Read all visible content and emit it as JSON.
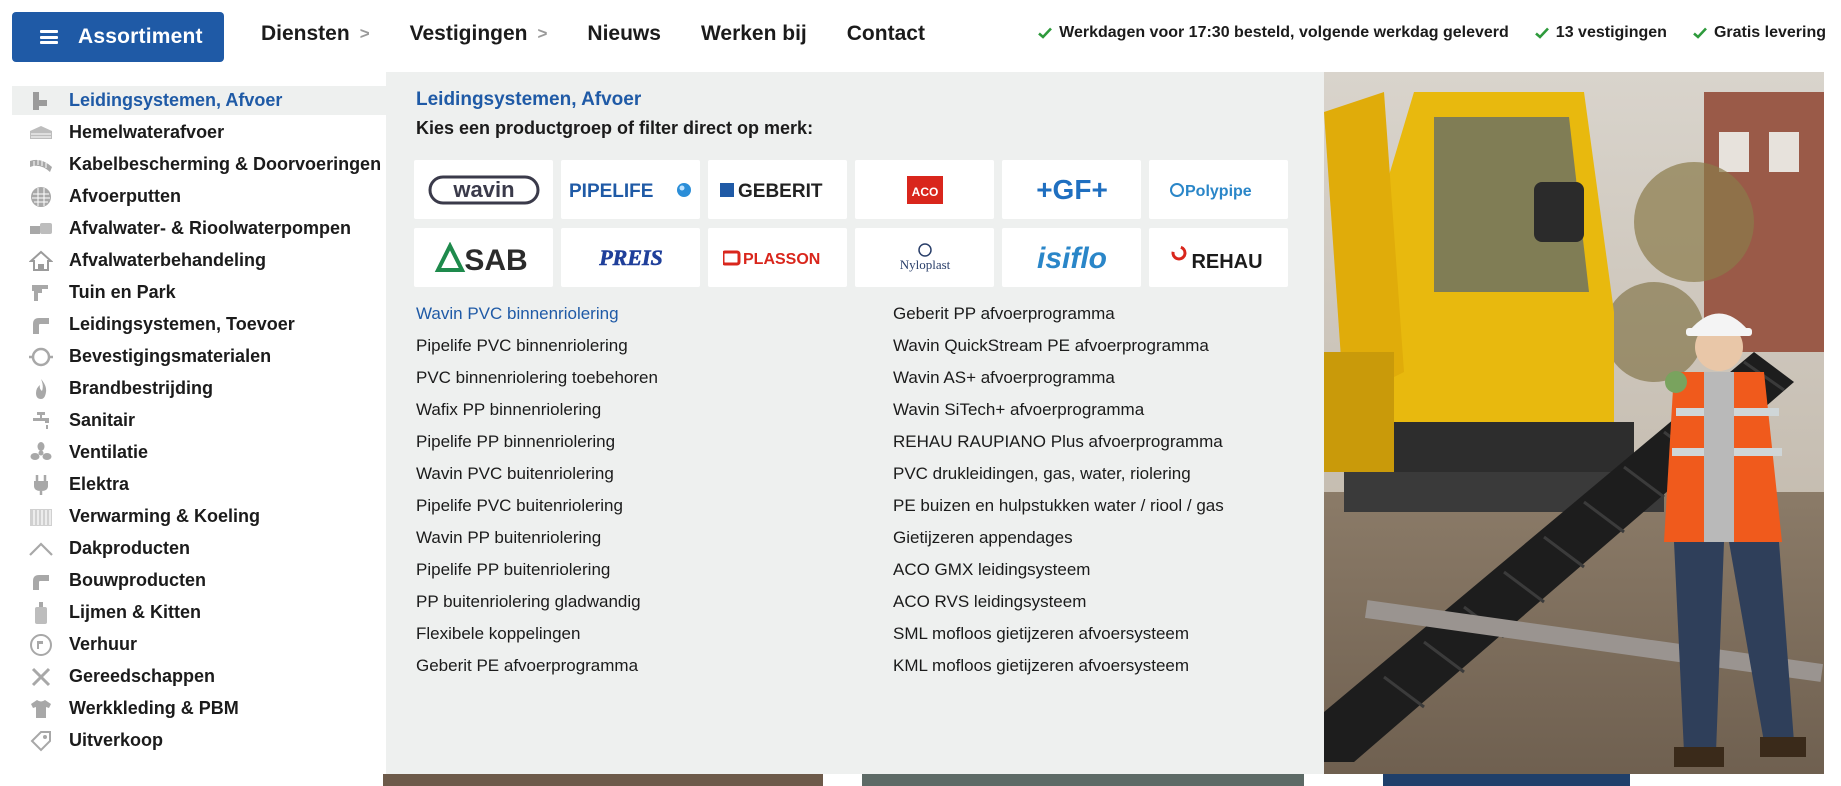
{
  "header": {
    "assortiment_label": "Assortiment",
    "nav": [
      {
        "label": "Diensten",
        "has_chevron": true
      },
      {
        "label": "Vestigingen",
        "has_chevron": true
      },
      {
        "label": "Nieuws",
        "has_chevron": false
      },
      {
        "label": "Werken bij",
        "has_chevron": false
      },
      {
        "label": "Contact",
        "has_chevron": false
      }
    ],
    "chevron_glyph": ">",
    "usps": [
      "Werkdagen voor 17:30 besteld, volgende werkdag geleverd",
      "13 vestigingen",
      "Gratis levering"
    ]
  },
  "sidebar": {
    "items": [
      {
        "label": "Leidingsystemen, Afvoer",
        "icon": "drain-pipe-icon",
        "active": true
      },
      {
        "label": "Hemelwaterafvoer",
        "icon": "gutter-icon"
      },
      {
        "label": "Kabelbescherming & Doorvoeringen",
        "icon": "cable-conduit-icon"
      },
      {
        "label": "Afvoerputten",
        "icon": "drain-grate-icon"
      },
      {
        "label": "Afvalwater- & Rioolwaterpompen",
        "icon": "pump-icon"
      },
      {
        "label": "Afvalwaterbehandeling",
        "icon": "house-treatment-icon"
      },
      {
        "label": "Tuin en Park",
        "icon": "garden-icon"
      },
      {
        "label": "Leidingsystemen, Toevoer",
        "icon": "pipe-elbow-icon"
      },
      {
        "label": "Bevestigingsmaterialen",
        "icon": "pipe-clamp-icon"
      },
      {
        "label": "Brandbestrijding",
        "icon": "flame-icon"
      },
      {
        "label": "Sanitair",
        "icon": "faucet-icon"
      },
      {
        "label": "Ventilatie",
        "icon": "fan-icon"
      },
      {
        "label": "Elektra",
        "icon": "plug-icon"
      },
      {
        "label": "Verwarming & Koeling",
        "icon": "radiator-icon"
      },
      {
        "label": "Dakproducten",
        "icon": "roof-icon"
      },
      {
        "label": "Bouwproducten",
        "icon": "building-material-icon"
      },
      {
        "label": "Lijmen & Kitten",
        "icon": "glue-tube-icon"
      },
      {
        "label": "Verhuur",
        "icon": "rental-icon"
      },
      {
        "label": "Gereedschappen",
        "icon": "tools-icon"
      },
      {
        "label": "Werkkleding & PBM",
        "icon": "shirt-icon"
      },
      {
        "label": "Uitverkoop",
        "icon": "tag-icon"
      }
    ]
  },
  "panel": {
    "title": "Leidingsystemen, Afvoer",
    "subtitle": "Kies een productgroep of filter direct op merk:",
    "brands": [
      {
        "name": "wavin",
        "logo": "wavin-logo"
      },
      {
        "name": "PIPELIFE",
        "logo": "pipelife-logo"
      },
      {
        "name": "GEBERIT",
        "logo": "geberit-logo"
      },
      {
        "name": "ACO",
        "logo": "aco-logo"
      },
      {
        "name": "+GF+",
        "logo": "gf-logo"
      },
      {
        "name": "Polypipe",
        "logo": "polypipe-logo"
      },
      {
        "name": "SAB",
        "logo": "sab-logo"
      },
      {
        "name": "PREIS",
        "logo": "preis-logo"
      },
      {
        "name": "PLASSON",
        "logo": "plasson-logo"
      },
      {
        "name": "Nyloplast",
        "logo": "nyloplast-logo"
      },
      {
        "name": "isiflo",
        "logo": "isiflo-logo"
      },
      {
        "name": "REHAU",
        "logo": "rehau-logo"
      }
    ],
    "links_left": [
      "Wavin PVC binnenriolering",
      "Pipelife PVC binnenriolering",
      "PVC binnenriolering toebehoren",
      "Wafix PP binnenriolering",
      "Pipelife PP binnenriolering",
      "Wavin PVC buitenriolering",
      "Pipelife PVC buitenriolering",
      "Wavin PP buitenriolering",
      "Pipelife PP buitenriolering",
      "PP buitenriolering gladwandig",
      "Flexibele koppelingen",
      "Geberit PE afvoerprogramma"
    ],
    "links_right": [
      "Geberit PP afvoerprogramma",
      "Wavin QuickStream PE afvoerprogramma",
      "Wavin AS+ afvoerprogramma",
      "Wavin SiTech+ afvoerprogramma",
      "REHAU RAUPIANO Plus afvoerprogramma",
      "PVC drukleidingen, gas, water, riolering",
      "PE buizen en hulpstukken water / riool / gas",
      "Gietijzeren appendages",
      "ACO GMX leidingsysteem",
      "ACO RVS leidingsysteem",
      "SML mofloos gietijzeren afvoersysteem",
      "KML mofloos gietijzeren afvoersysteem"
    ]
  },
  "colors": {
    "brand_blue": "#1f5aa6",
    "check_green": "#2e9a3c",
    "panel_bg": "#eef0ef",
    "icon_grey": "#9b9b9b"
  },
  "photo": {
    "icon": "construction-worker-photo"
  }
}
